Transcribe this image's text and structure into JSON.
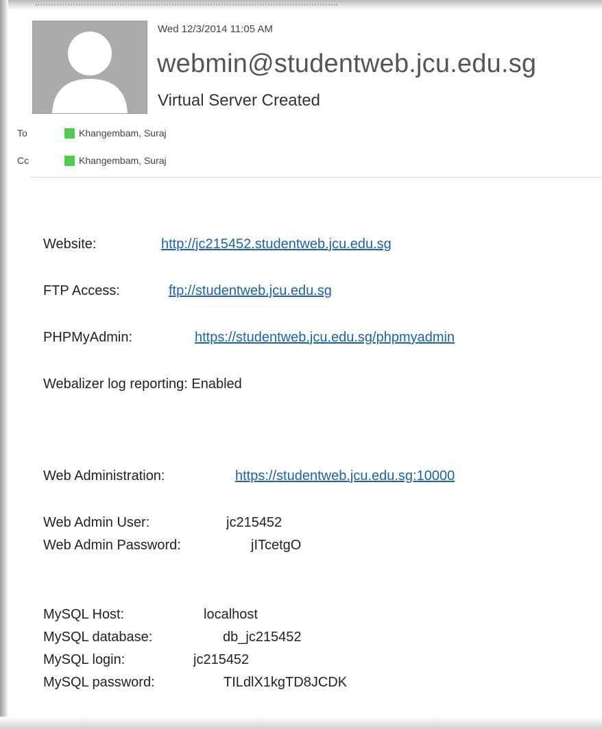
{
  "header": {
    "date": "Wed 12/3/2014 11:05 AM",
    "sender": "webmin@studentweb.jcu.edu.sg",
    "subject": "Virtual Server Created",
    "to_label": "To",
    "to_name": "Khangembam, Suraj",
    "cc_label": "Cc",
    "cc_name": "Khangembam, Suraj",
    "presence_color": "#4cce4c"
  },
  "body": {
    "website_label": "Website:",
    "website_link": "http://jc215452.studentweb.jcu.edu.sg",
    "ftp_label": "FTP Access:",
    "ftp_link": "ftp://studentweb.jcu.edu.sg",
    "phpmyadmin_label": "PHPMyAdmin:",
    "phpmyadmin_link": "https://studentweb.jcu.edu.sg/phpmyadmin",
    "webalizer_text": "Webalizer log reporting: Enabled",
    "webadmin_label": "Web Administration:",
    "webadmin_link": "https://studentweb.jcu.edu.sg:10000",
    "admin_user_label": "Web Admin User:",
    "admin_user_value": "jc215452",
    "admin_password_label": "Web Admin Password:",
    "admin_password_value": "jITcetgO",
    "mysql_host_label": "MySQL Host:",
    "mysql_host_value": "localhost",
    "mysql_db_label": "MySQL database:",
    "mysql_db_value": "db_jc215452",
    "mysql_login_label": "MySQL login:",
    "mysql_login_value": "jc215452",
    "mysql_password_label": "MySQL password:",
    "mysql_password_value": "TILdlX1kgTD8JCDK"
  }
}
